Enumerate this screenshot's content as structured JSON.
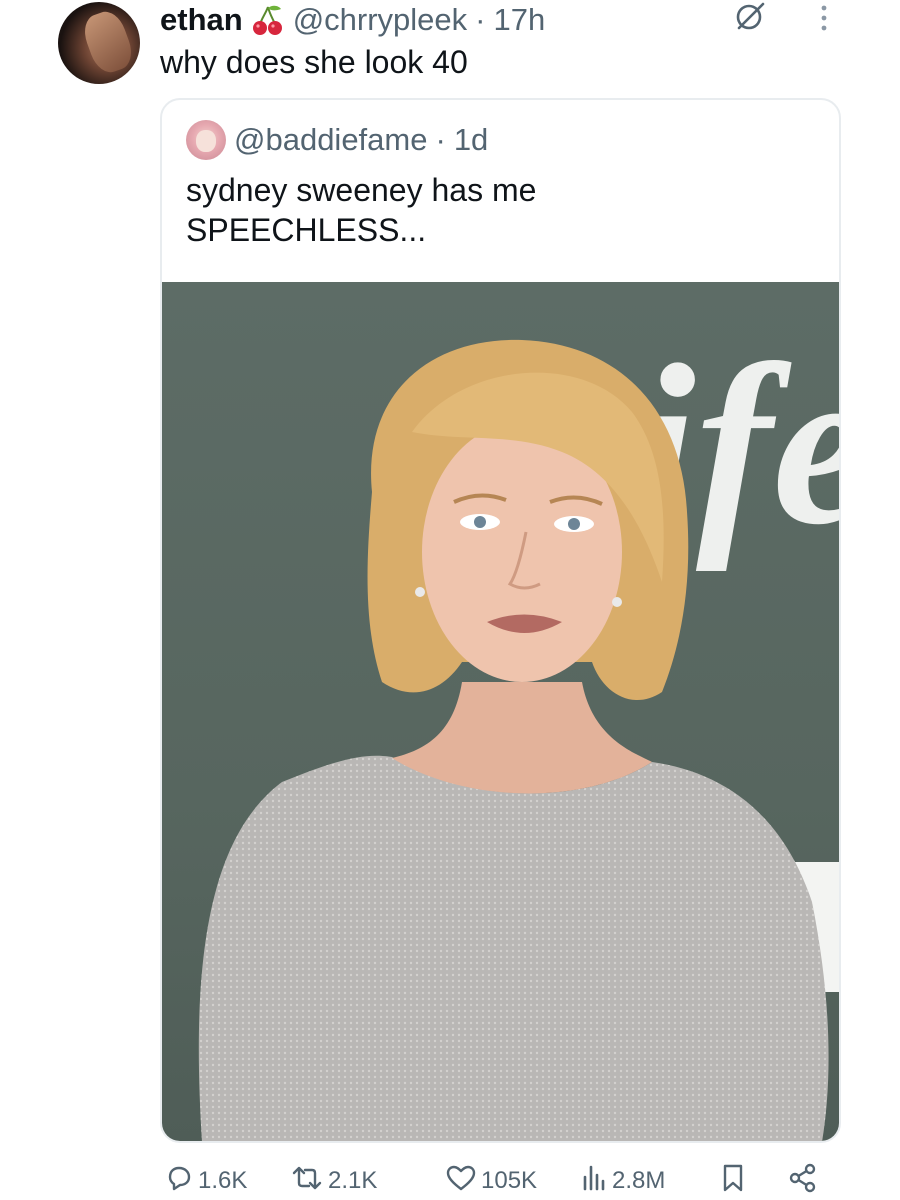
{
  "tweet": {
    "display_name": "ethan",
    "handle": "@chrrypleek",
    "separator": "·",
    "time": "17h",
    "text": "why does she look 40"
  },
  "quote": {
    "handle": "@baddiefame",
    "separator": "·",
    "time": "1d",
    "text_lines": [
      "sydney sweeney has me",
      "SPEECHLESS..."
    ],
    "image_backdrop_text": "ife"
  },
  "actions": {
    "replies": "1.6K",
    "reposts": "2.1K",
    "likes": "105K",
    "views": "2.8M"
  },
  "icons": {
    "name_emoji": "cherry-icon",
    "grok": "grok-icon",
    "more": "more-vertical-icon",
    "reply": "reply-icon",
    "retweet": "retweet-icon",
    "like": "heart-icon",
    "views": "views-chart-icon",
    "bookmark": "bookmark-icon",
    "share": "share-icon"
  },
  "colors": {
    "text": "#0f1419",
    "secondary": "#536471",
    "border": "#e8ecef",
    "photo_background": "#57665f"
  }
}
